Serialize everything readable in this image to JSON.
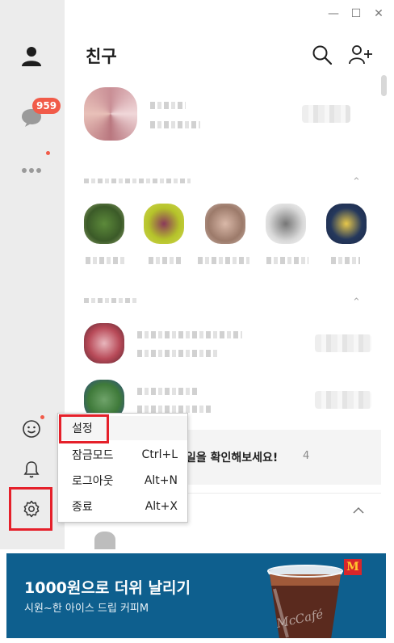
{
  "window": {
    "controls": {
      "minimize": "—",
      "maximize": "☐",
      "close": "✕"
    }
  },
  "header": {
    "title": "친구",
    "icons": [
      "search-icon",
      "add-friend-icon"
    ]
  },
  "sidebar": {
    "items": [
      "person-icon",
      "chat-bubble-icon",
      "more-icon",
      "emoji-icon",
      "bell-icon",
      "gear-icon"
    ],
    "chat_badge": "959"
  },
  "notice": {
    "text": "일을 확인해보세요!",
    "count": "4"
  },
  "context_menu": {
    "items": [
      {
        "label": "설정",
        "shortcut": ""
      },
      {
        "label": "잠금모드",
        "shortcut": "Ctrl+L"
      },
      {
        "label": "로그아웃",
        "shortcut": "Alt+N"
      },
      {
        "label": "종료",
        "shortcut": "Alt+X"
      }
    ]
  },
  "ad": {
    "title": "1000원으로 더위 날리기",
    "subtitle": "시원~한 아이스 드립 커피M",
    "logo": "M",
    "cup_text": "McCafé"
  },
  "colors": {
    "sidebar_bg": "#ececec",
    "badge": "#f15b49",
    "highlight_box": "#e5202a",
    "ad_bg": "#0e5f8e"
  }
}
